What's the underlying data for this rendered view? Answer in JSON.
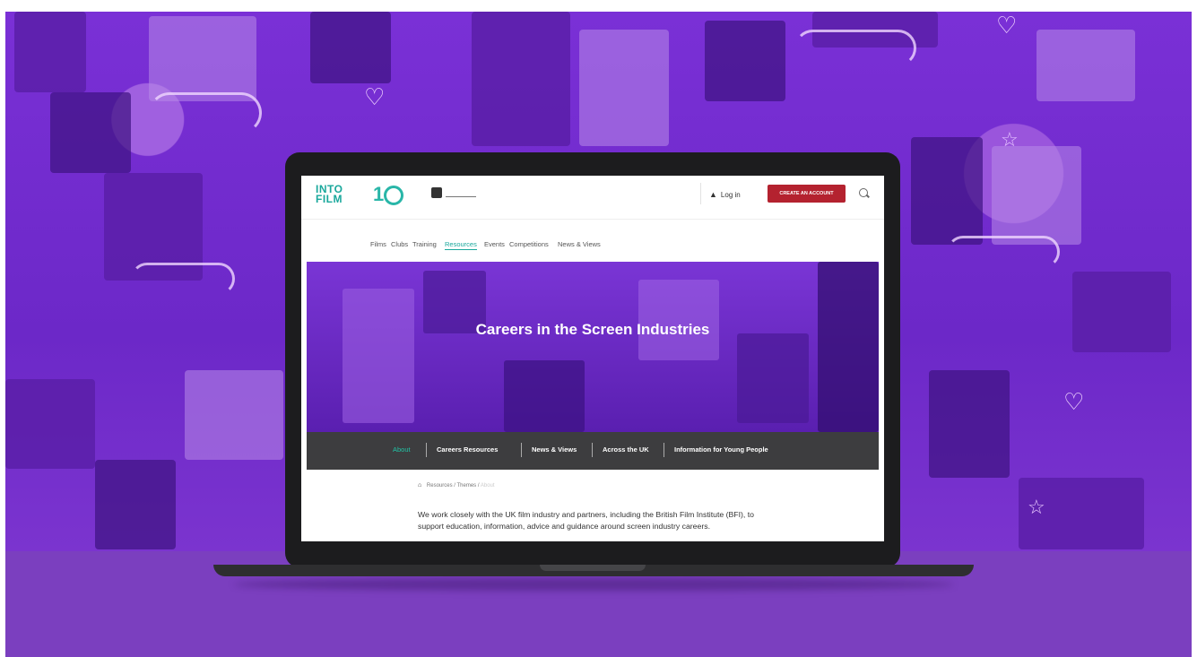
{
  "site": {
    "logo_text_line1": "INTO",
    "logo_text_line2": "FILM",
    "logo_anniversary": "1",
    "login_label": "Log in",
    "create_account_label": "CREATE AN ACCOUNT"
  },
  "nav": {
    "items": [
      "Films",
      "Clubs",
      "Training",
      "Resources",
      "Events",
      "Competitions",
      "News & Views"
    ],
    "active": "Resources"
  },
  "hero": {
    "title": "Careers in the Screen Industries"
  },
  "subnav": {
    "items": [
      "About",
      "Careers Resources",
      "News & Views",
      "Across the UK",
      "Information for Young People"
    ],
    "active": "About"
  },
  "breadcrumb": {
    "items": [
      "Resources",
      "Themes",
      "About"
    ]
  },
  "intro": {
    "text": "We work closely with the UK film industry and partners, including the British Film Institute (BFI), to support education, information, advice and guidance around screen industry careers."
  },
  "colors": {
    "background_purple": "#7a30d6",
    "floor_purple": "#7b3fbf",
    "brand_teal": "#1aa89c",
    "create_button_red": "#b4222f",
    "subnav_gray": "#3d3d3f"
  }
}
